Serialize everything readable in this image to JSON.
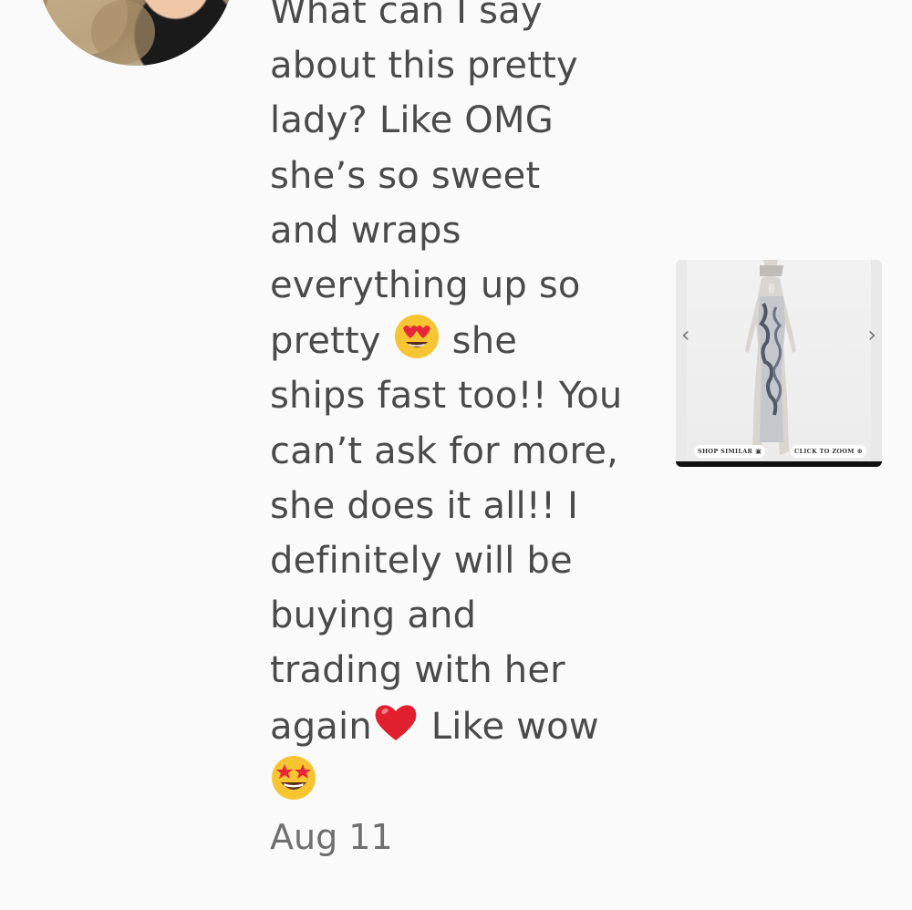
{
  "review": {
    "lines": [
      "What can I say",
      "about this pretty",
      "lady? Like OMG",
      "she’s so sweet",
      "and wraps",
      "everything up so",
      "pretty",
      "she",
      "ships fast too!! You",
      "can’t ask for more,",
      "she does it all!! I",
      "definitely will be",
      "buying and",
      "trading with her",
      "again",
      " Like wow"
    ],
    "emojis": [
      "heart-eyes-emoji",
      "red-heart-emoji",
      "star-struck-emoji"
    ]
  },
  "date": "Aug 11",
  "product": {
    "arrow_left": "‹",
    "arrow_right": "›",
    "shop_similar_label": "SHOP SIMILAR",
    "click_to_zoom_label": "CLICK TO ZOOM",
    "shop_icon": "shop-icon",
    "zoom_icon": "zoom-icon"
  }
}
